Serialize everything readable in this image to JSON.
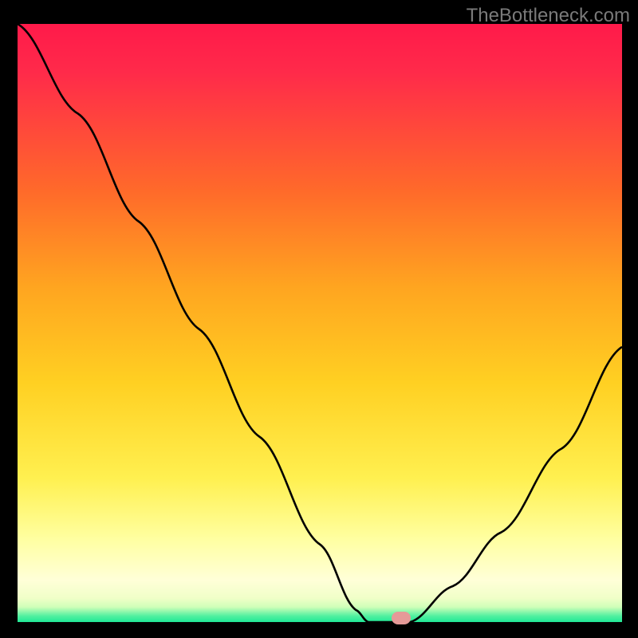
{
  "attribution": "TheBottleneck.com",
  "marker": {
    "x_frac": 0.635,
    "y_frac": 0.993
  },
  "chart_data": {
    "type": "line",
    "title": "",
    "xlabel": "",
    "ylabel": "",
    "xlim": [
      0,
      1
    ],
    "ylim": [
      0,
      1
    ],
    "series": [
      {
        "name": "bottleneck-curve",
        "x": [
          0.0,
          0.1,
          0.2,
          0.3,
          0.4,
          0.5,
          0.56,
          0.58,
          0.63,
          0.65,
          0.72,
          0.8,
          0.9,
          1.0
        ],
        "y": [
          1.0,
          0.85,
          0.67,
          0.49,
          0.31,
          0.13,
          0.02,
          0.0,
          0.0,
          0.0,
          0.06,
          0.15,
          0.29,
          0.46
        ]
      }
    ],
    "annotations": [
      {
        "name": "marker",
        "x": 0.635,
        "y": 0.0,
        "color": "#e69a98"
      }
    ],
    "gradient_stops": [
      {
        "pos": 0.0,
        "color": "#ff1a4a"
      },
      {
        "pos": 0.5,
        "color": "#ffd022"
      },
      {
        "pos": 0.9,
        "color": "#ffffa0"
      },
      {
        "pos": 1.0,
        "color": "#20e896"
      }
    ]
  }
}
